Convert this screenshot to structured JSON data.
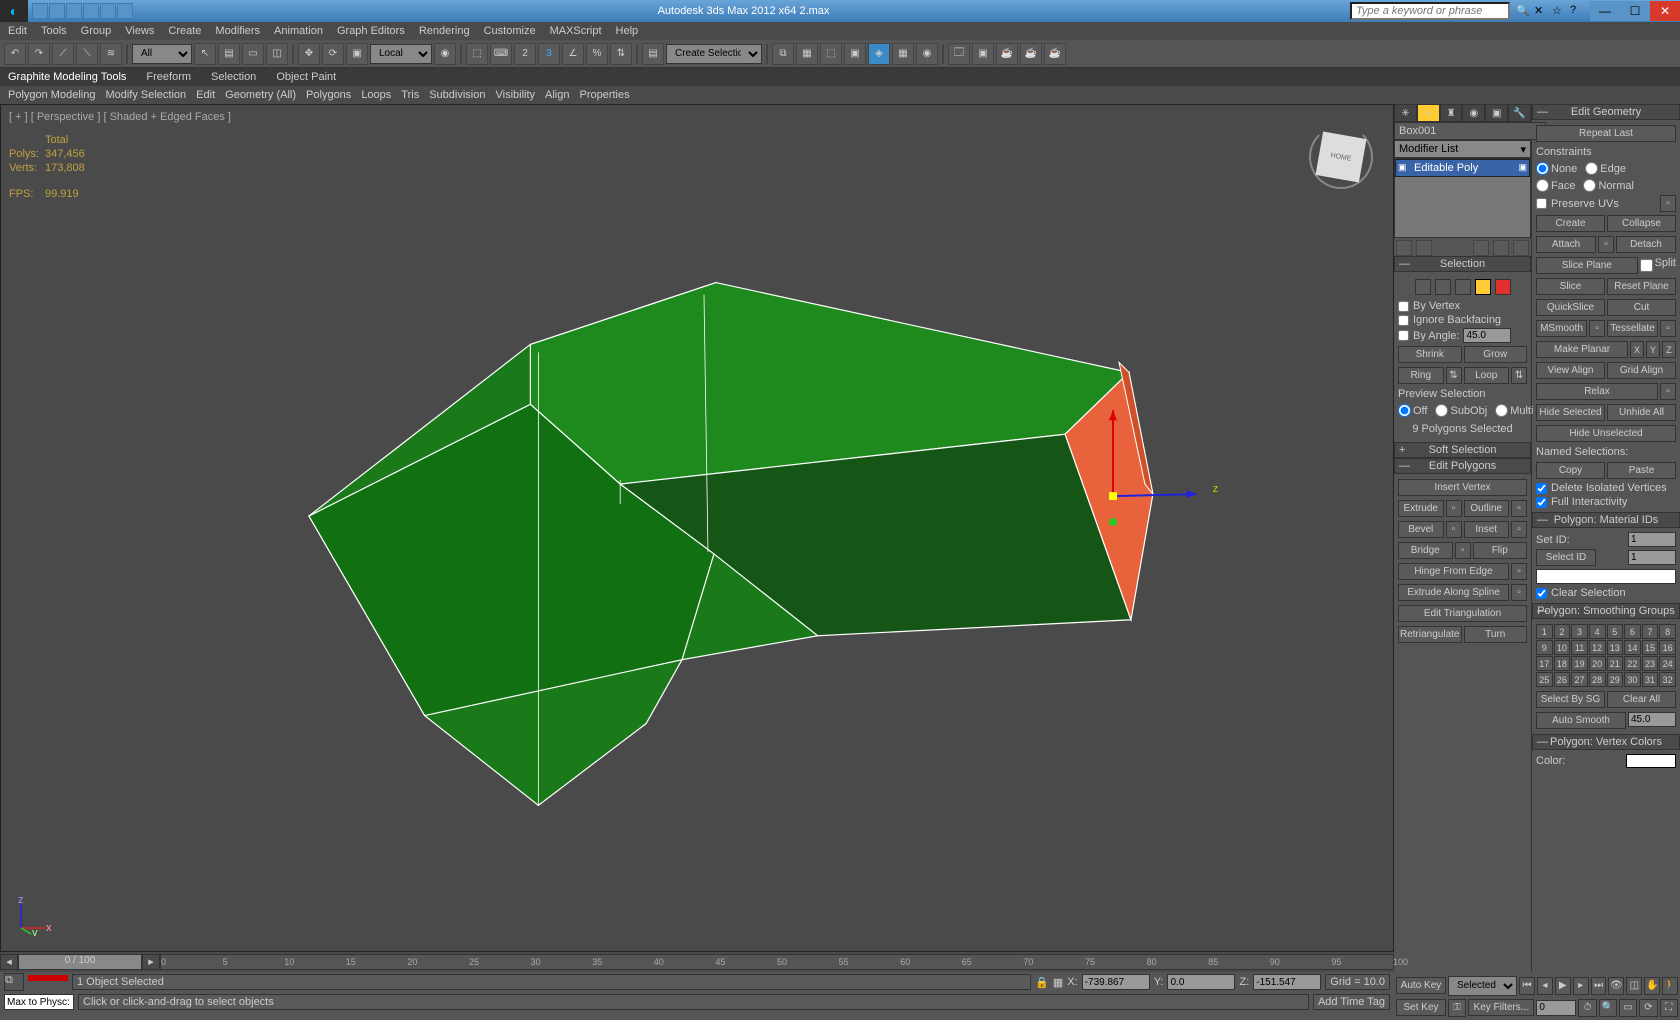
{
  "title": "Autodesk 3ds Max 2012 x64    2.max",
  "search_placeholder": "Type a keyword or phrase",
  "menus": [
    "Edit",
    "Tools",
    "Group",
    "Views",
    "Create",
    "Modifiers",
    "Animation",
    "Graph Editors",
    "Rendering",
    "Customize",
    "MAXScript",
    "Help"
  ],
  "toolbar": {
    "selection_filter": "All",
    "ref_coord": "Local",
    "create_sel": "Create Selection Se"
  },
  "ribbon_tabs": [
    "Graphite Modeling Tools",
    "Freeform",
    "Selection",
    "Object Paint"
  ],
  "ribbon_panels": [
    "Polygon Modeling",
    "Modify Selection",
    "Edit",
    "Geometry (All)",
    "Polygons",
    "Loops",
    "Tris",
    "Subdivision",
    "Visibility",
    "Align",
    "Properties"
  ],
  "viewport": {
    "label": "[ + ] [ Perspective ] [ Shaded + Edged Faces ]",
    "stats": {
      "total": "Total",
      "polys_label": "Polys:",
      "polys": "347,456",
      "verts_label": "Verts:",
      "verts": "173,808",
      "fps_label": "FPS:",
      "fps": "99.919"
    },
    "axis": {
      "x": "x",
      "y": "y",
      "z": "z"
    }
  },
  "cmdpanel": {
    "object_name": "Box001",
    "modifier_list": "Modifier List",
    "modifier_item": "Editable Poly",
    "selection": {
      "header": "Selection",
      "by_vertex": "By Vertex",
      "ignore_backfacing": "Ignore Backfacing",
      "by_angle": "By Angle:",
      "by_angle_val": "45.0",
      "shrink": "Shrink",
      "grow": "Grow",
      "ring": "Ring",
      "loop": "Loop",
      "preview_label": "Preview Selection",
      "off": "Off",
      "subobj": "SubObj",
      "multi": "Multi",
      "count": "9 Polygons Selected"
    },
    "soft_selection": "Soft Selection",
    "edit_polygons": {
      "header": "Edit Polygons",
      "insert_vertex": "Insert Vertex",
      "extrude": "Extrude",
      "outline": "Outline",
      "bevel": "Bevel",
      "inset": "Inset",
      "bridge": "Bridge",
      "flip": "Flip",
      "hinge": "Hinge From Edge",
      "extrude_spline": "Extrude Along Spline",
      "edit_tri": "Edit Triangulation",
      "retriangulate": "Retriangulate",
      "turn": "Turn"
    }
  },
  "edit_geometry": {
    "header": "Edit Geometry",
    "repeat_last": "Repeat Last",
    "constraints": "Constraints",
    "none": "None",
    "edge": "Edge",
    "face": "Face",
    "normal": "Normal",
    "preserve_uvs": "Preserve UVs",
    "create": "Create",
    "collapse": "Collapse",
    "attach": "Attach",
    "detach": "Detach",
    "slice_plane": "Slice Plane",
    "split": "Split",
    "slice": "Slice",
    "reset_plane": "Reset Plane",
    "quickslice": "QuickSlice",
    "cut": "Cut",
    "msmooth": "MSmooth",
    "tessellate": "Tessellate",
    "make_planar": "Make Planar",
    "view_align": "View Align",
    "grid_align": "Grid Align",
    "relax": "Relax",
    "hide_selected": "Hide Selected",
    "unhide_all": "Unhide All",
    "hide_unselected": "Hide Unselected",
    "named_selections": "Named Selections:",
    "copy": "Copy",
    "paste": "Paste",
    "delete_isolated": "Delete Isolated Vertices",
    "full_interactivity": "Full Interactivity"
  },
  "material_ids": {
    "header": "Polygon: Material IDs",
    "set_id": "Set ID:",
    "set_id_val": "1",
    "select_id": "Select ID",
    "select_id_val": "1",
    "clear_selection": "Clear Selection"
  },
  "smoothing_groups": {
    "header": "Polygon: Smoothing Groups",
    "select_by_sg": "Select By SG",
    "clear_all": "Clear All",
    "auto_smooth": "Auto Smooth",
    "auto_smooth_val": "45.0"
  },
  "vertex_colors": {
    "header": "Polygon: Vertex Colors",
    "color": "Color:"
  },
  "timeline": {
    "slider": "0 / 100",
    "ticks": [
      "0",
      "5",
      "10",
      "15",
      "20",
      "25",
      "30",
      "35",
      "40",
      "45",
      "50",
      "55",
      "60",
      "65",
      "70",
      "75",
      "80",
      "85",
      "90",
      "95",
      "100"
    ]
  },
  "status": {
    "selected": "1 Object Selected",
    "hint": "Click or click-and-drag to select objects",
    "x": "-739.867",
    "y": "0.0",
    "z": "-151.547",
    "grid": "Grid = 10.0",
    "auto_key": "Auto Key",
    "set_key": "Set Key",
    "key_filters": "Key Filters...",
    "add_time_tag": "Add Time Tag",
    "selected_mode": "Selected",
    "maxscript": "Max to Physc:"
  }
}
